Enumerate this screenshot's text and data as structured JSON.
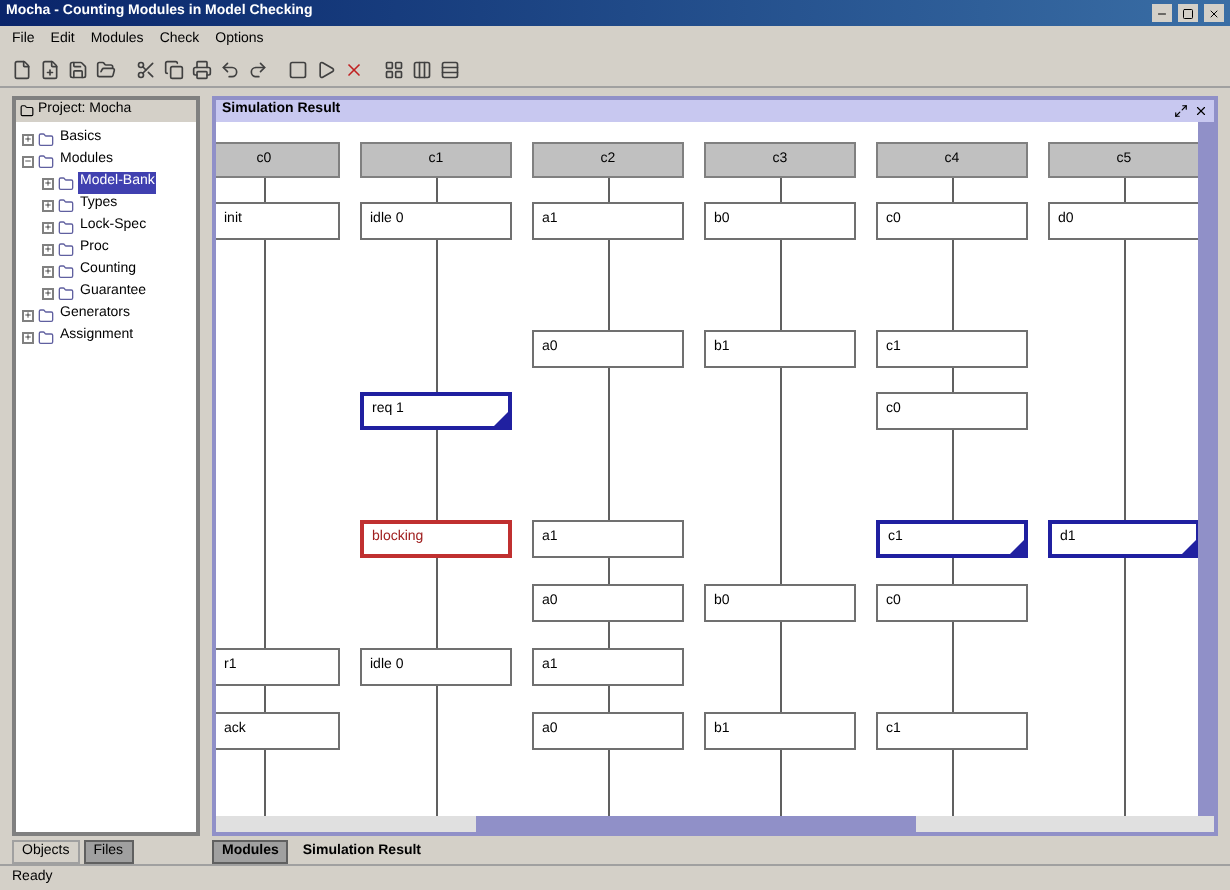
{
  "window": {
    "title": "Mocha - Counting Modules in Model Checking"
  },
  "menu": [
    "File",
    "Edit",
    "Modules",
    "Check",
    "Options"
  ],
  "project_panel": {
    "title": "Project: Mocha",
    "tree": [
      {
        "label": "Basics",
        "expanded": false,
        "selected": false
      },
      {
        "label": "Modules",
        "expanded": true,
        "selected": false,
        "children": [
          {
            "label": "Model-Bank",
            "expanded": false,
            "selected": true
          },
          {
            "label": "Types",
            "expanded": false,
            "selected": false
          },
          {
            "label": "Lock-Spec",
            "expanded": false,
            "selected": false
          },
          {
            "label": "Proc",
            "expanded": false,
            "selected": false
          },
          {
            "label": "Counting",
            "expanded": false,
            "selected": false
          },
          {
            "label": "Guarantee",
            "expanded": false,
            "selected": false
          }
        ]
      },
      {
        "label": "Generators",
        "expanded": false,
        "selected": false
      },
      {
        "label": "Assignment",
        "expanded": false,
        "selected": false
      }
    ],
    "tabs": [
      {
        "label": "Objects",
        "selected": false
      },
      {
        "label": "Files",
        "selected": true
      }
    ]
  },
  "simulation": {
    "title": "Simulation Result",
    "columns": [
      "c0",
      "c1",
      "c2",
      "c3",
      "c4",
      "c5"
    ],
    "rows": [
      {
        "cells": [
          {
            "text": "init",
            "kind": "plain"
          },
          {
            "text": "idle 0",
            "kind": "plain"
          },
          {
            "text": "a1",
            "kind": "plain"
          },
          {
            "text": "b0",
            "kind": "plain"
          },
          {
            "text": "c0",
            "kind": "plain"
          },
          {
            "text": "d0",
            "kind": "plain"
          }
        ]
      },
      {
        "cells": [
          null,
          null,
          {
            "text": "a0",
            "kind": "plain"
          },
          {
            "text": "b1",
            "kind": "plain"
          },
          {
            "text": "c1",
            "kind": "plain"
          },
          null
        ]
      },
      {
        "cells": [
          null,
          {
            "text": "req 1",
            "kind": "marked"
          },
          null,
          null,
          {
            "text": "c0",
            "kind": "plain"
          },
          null
        ]
      },
      {
        "cells": [
          null,
          {
            "text": "blocking",
            "kind": "error"
          },
          {
            "text": "a1",
            "kind": "plain"
          },
          null,
          {
            "text": "c1",
            "kind": "marked"
          },
          {
            "text": "d1",
            "kind": "marked"
          }
        ]
      },
      {
        "cells": [
          null,
          null,
          {
            "text": "a0",
            "kind": "plain"
          },
          {
            "text": "b0",
            "kind": "plain"
          },
          {
            "text": "c0",
            "kind": "plain"
          },
          null
        ]
      },
      {
        "cells": [
          {
            "text": "r1",
            "kind": "plain"
          },
          {
            "text": "idle 0",
            "kind": "plain"
          },
          {
            "text": "a1",
            "kind": "plain"
          },
          null,
          null,
          null
        ]
      },
      {
        "cells": [
          {
            "text": "ack",
            "kind": "plain"
          },
          null,
          {
            "text": "a0",
            "kind": "plain"
          },
          {
            "text": "b1",
            "kind": "plain"
          },
          {
            "text": "c1",
            "kind": "plain"
          },
          null
        ]
      }
    ],
    "tabs": [
      {
        "label": "Modules",
        "selected": true
      },
      {
        "label": "Simulation Result",
        "selected": false
      }
    ]
  },
  "status_bar": "Ready"
}
